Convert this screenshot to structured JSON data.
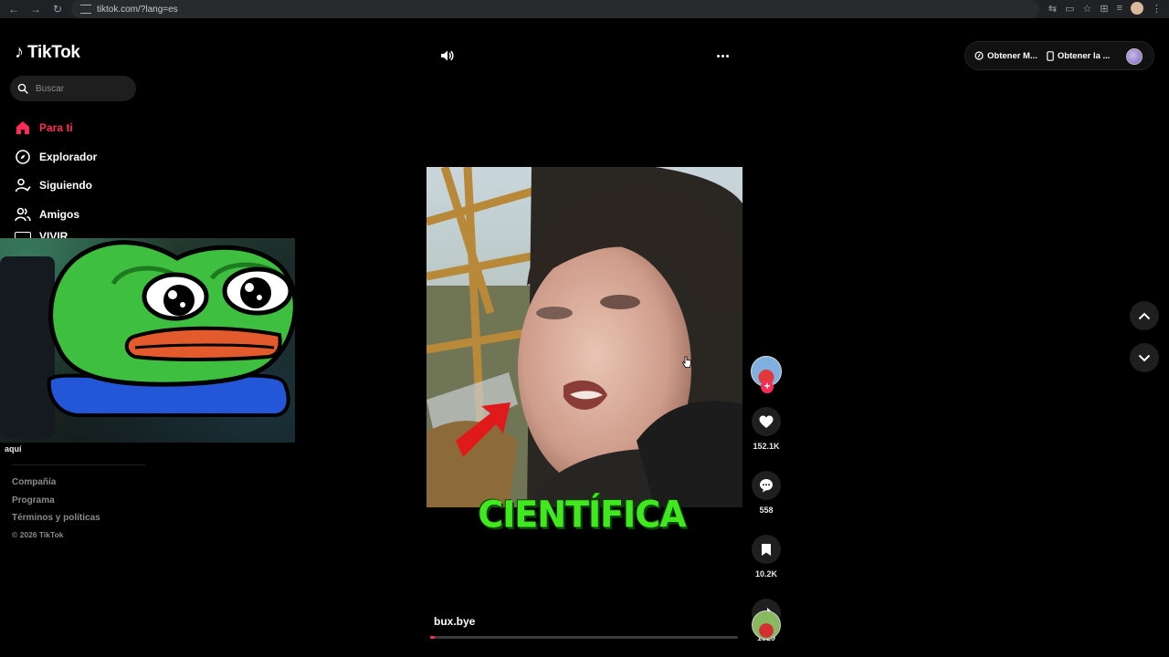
{
  "browser": {
    "url": "tiktok.com/?lang=es",
    "nav_icons": [
      "back-icon",
      "forward-icon",
      "reload-icon"
    ],
    "right_icons": [
      "translate-icon",
      "cast-icon",
      "star-icon",
      "extensions-icon",
      "tab-search-icon",
      "profile-icon",
      "kebab-icon"
    ]
  },
  "brand": {
    "name": "TikTok",
    "color": "#fe2c55"
  },
  "search": {
    "placeholder": "Buscar"
  },
  "sidebar": {
    "items": [
      {
        "label": "Para ti",
        "icon": "home-icon",
        "active": true
      },
      {
        "label": "Explorador",
        "icon": "compass-icon",
        "active": false
      },
      {
        "label": "Siguiendo",
        "icon": "following-icon",
        "active": false
      },
      {
        "label": "Amigos",
        "icon": "friends-icon",
        "active": false
      }
    ],
    "live_label": "VIVIR",
    "overlay_caption": "aquí",
    "footer": [
      "Compañía",
      "Programa",
      "Términos y políticas"
    ],
    "copyright": "© 2026 TikTok"
  },
  "topbar": {
    "sound_icon": "volume-icon",
    "more_icon": "more-horizontal-icon",
    "get_coins": "Obtener M...",
    "get_app": "Obtener la ..."
  },
  "video": {
    "caption_overlay": "CIENTÍFICA",
    "username": "bux.bye",
    "progress_fraction": 0.015
  },
  "actions": {
    "likes": "152.1K",
    "comments": "558",
    "saves": "10.2K",
    "shares": "1929"
  }
}
